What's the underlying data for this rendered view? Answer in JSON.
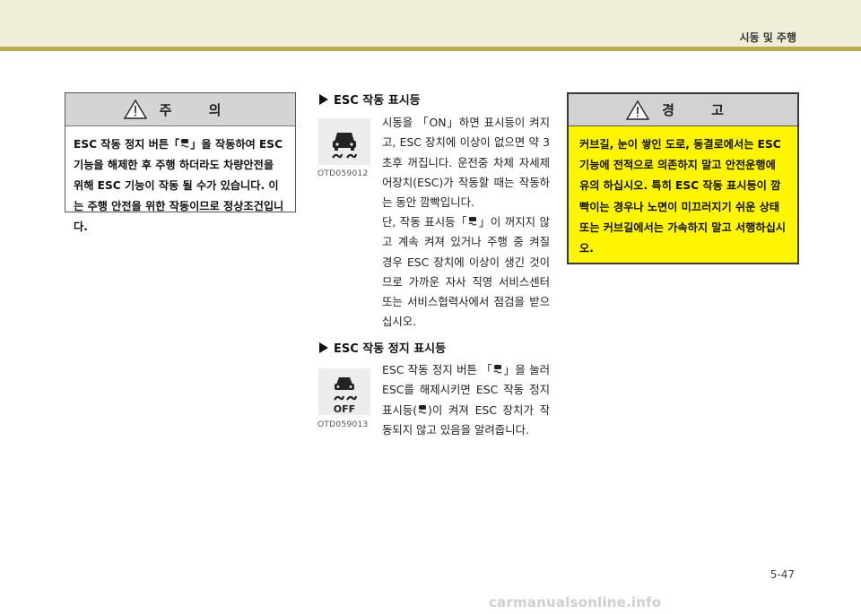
{
  "header": {
    "title": "시동 및 주행"
  },
  "caution": {
    "title": "주 의",
    "body_pre": "ESC 작동 정지 버튼「",
    "body_post": "」을 작동하여 ESC 기능을 해제한 후 주행 하더라도 차량안전을 위해 ESC 기능이 작동 될 수가 있습니다. 이는 주행 안전을 위한 작동이므로 정상조건입니다."
  },
  "esc_indicator": {
    "heading": "ESC 작동 표시등",
    "image_caption": "OTD059012",
    "p1": "시동을 「ON」하면 표시등이 켜지고, ESC 장치에 이상이 없으면 약 3초후 꺼집니다. 운전중 차체 자세제어장치(ESC)가 작동할 때는 작동하는 동안 깜빡입니다.",
    "p2_pre": "단, 작동 표시등「",
    "p2_post": "」이 꺼지지 않고 계속 켜져 있거나 주행 중 켜질 경우 ESC 장치에 이상이 생긴 것이므로 가까운 자사 직영 서비스센터 또는 서비스협력사에서 점검을 받으십시오."
  },
  "esc_off_indicator": {
    "heading": "ESC 작동 정지 표시등",
    "image_caption": "OTD059013",
    "icon_text": "OFF",
    "p_pre": "ESC 작동 정지 버튼 「",
    "p_mid": "」을 눌러 ESC를 해제시키면 ESC 작동 정지 표시등(",
    "p_post": ")이 켜져 ESC 장치가 작동되지 않고 있음을 알려줍니다."
  },
  "warning": {
    "title": "경 고",
    "body": "커브길, 눈이 쌓인 도로, 동결로에서는 ESC 기능에 전적으로 의존하지 말고 안전운행에 유의 하십시오. 특히 ESC 작동 표시등이 깜빡이는 경우나 노면이 미끄러지기 쉬운 상태 또는 커브길에서는 가속하지 말고 서행하십시오."
  },
  "page_number": "5-47",
  "watermark": "carmanualsonline.info",
  "icons": [
    "warning-triangle-icon",
    "esc-skid-car-icon",
    "esc-off-icon"
  ]
}
